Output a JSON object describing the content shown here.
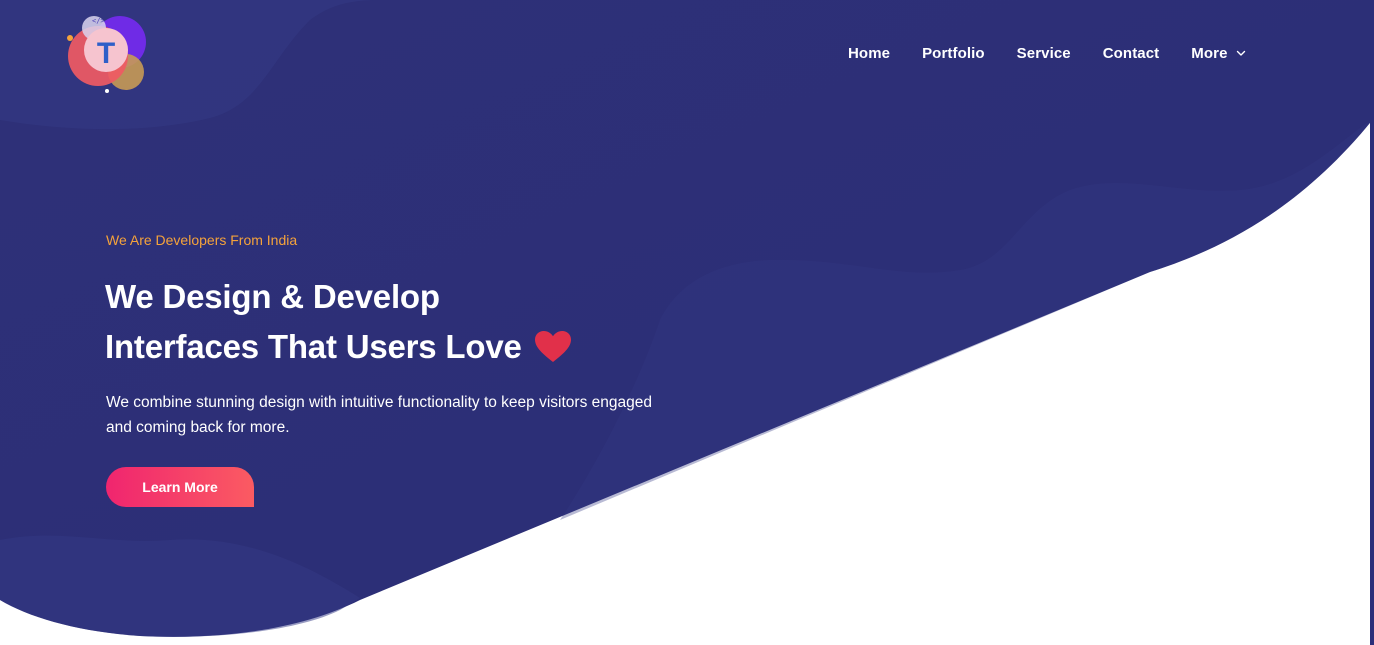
{
  "brand": {
    "logo_letter": "T",
    "logo_code_glyph": "</>"
  },
  "nav": {
    "items": [
      {
        "label": "Home"
      },
      {
        "label": "Portfolio"
      },
      {
        "label": "Service"
      },
      {
        "label": "Contact"
      },
      {
        "label": "More"
      }
    ]
  },
  "hero": {
    "eyebrow": "We Are Developers From India",
    "headline_line1": "We Design & Develop",
    "headline_line2": "Interfaces That Users Love",
    "description": "We combine stunning design with intuitive functionality to keep visitors engaged and coming back for more.",
    "cta_label": "Learn More"
  },
  "colors": {
    "hero_bg": "#2d3079",
    "accent_orange": "#f5a33b",
    "cta_gradient_start": "#f0256f",
    "cta_gradient_end": "#fb5b62",
    "heart": "#e1304a"
  }
}
